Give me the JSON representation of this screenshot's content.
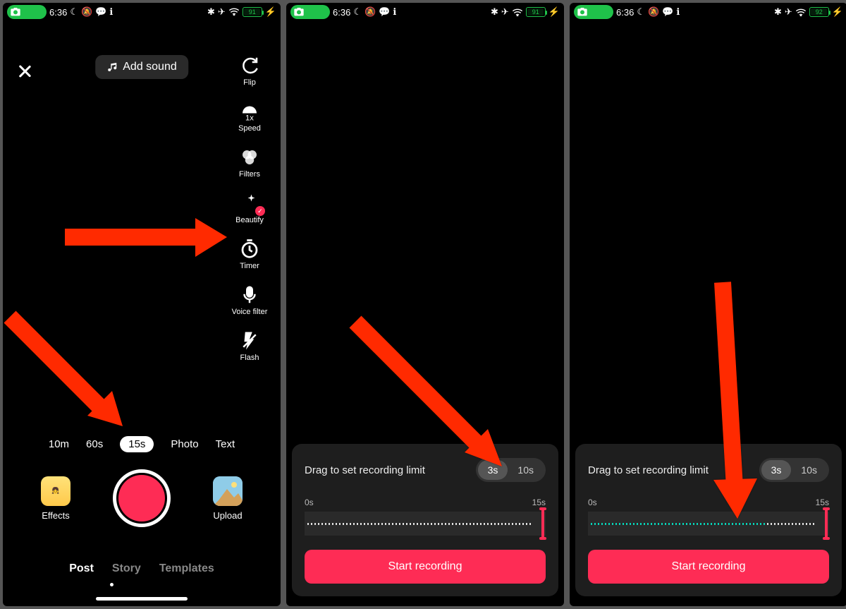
{
  "status": {
    "time": "6:36",
    "battery1": "91",
    "battery2": "91",
    "battery3": "92"
  },
  "screen1": {
    "add_sound": "Add sound",
    "tools": {
      "flip": "Flip",
      "speed": "Speed",
      "filters": "Filters",
      "beautify": "Beautify",
      "timer": "Timer",
      "voice_filter": "Voice filter",
      "flash": "Flash"
    },
    "durations": {
      "d10m": "10m",
      "d60s": "60s",
      "d15s": "15s",
      "photo": "Photo",
      "text": "Text"
    },
    "effects": "Effects",
    "upload": "Upload",
    "modes": {
      "post": "Post",
      "story": "Story",
      "templates": "Templates"
    }
  },
  "timer_panel": {
    "title": "Drag to set recording limit",
    "opt3s": "3s",
    "opt10s": "10s",
    "start_label": "0s",
    "end_label": "15s",
    "button": "Start recording"
  }
}
